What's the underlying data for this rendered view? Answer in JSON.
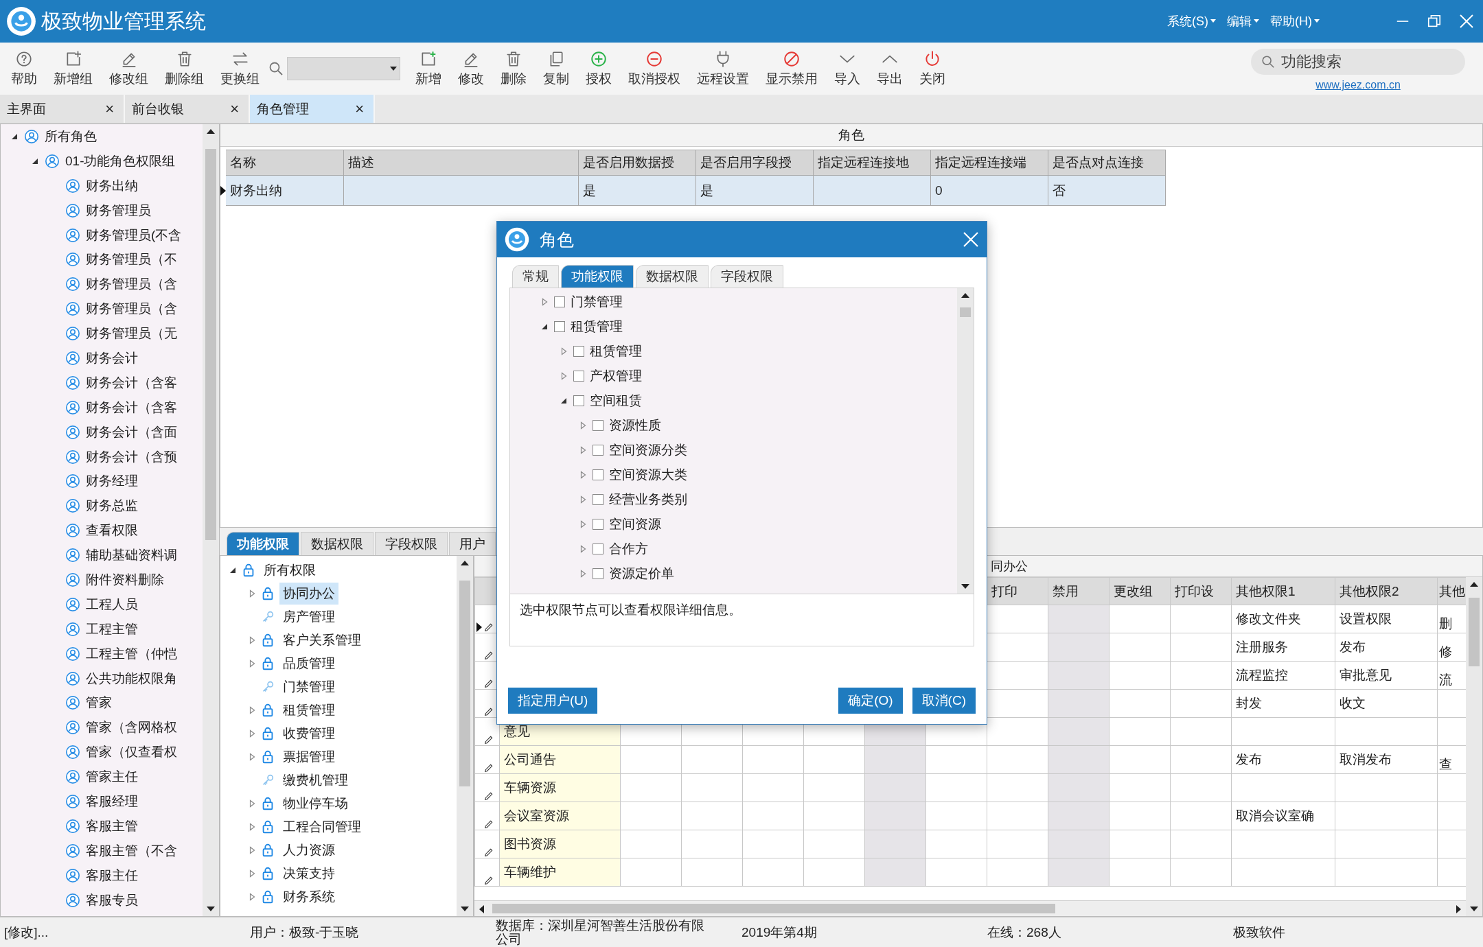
{
  "window": {
    "title": "极致物业管理系统",
    "menus": [
      "系统(S)",
      "编辑",
      "帮助(H)"
    ]
  },
  "toolbar": {
    "group_buttons": [
      "帮助",
      "新增组",
      "修改组",
      "删除组",
      "更换组"
    ],
    "buttons": [
      "新增",
      "修改",
      "删除",
      "复制",
      "授权",
      "取消授权",
      "远程设置",
      "显示禁用",
      "导入",
      "导出",
      "关闭"
    ],
    "search": {
      "placeholder": "功能搜索"
    },
    "link": "www.jeez.com.cn"
  },
  "tabs": [
    {
      "label": "主界面",
      "close": "×",
      "selected": false
    },
    {
      "label": "前台收银",
      "close": "×",
      "selected": false
    },
    {
      "label": "角色管理",
      "close": "×",
      "selected": true
    }
  ],
  "role_tree": {
    "label": "所有角色",
    "expanded": true,
    "children": [
      {
        "label": "01-功能角色权限组",
        "expanded": true,
        "children": [
          {
            "label": "财务出纳"
          },
          {
            "label": "财务管理员"
          },
          {
            "label": "财务管理员(不含"
          },
          {
            "label": "财务管理员（不"
          },
          {
            "label": "财务管理员（含"
          },
          {
            "label": "财务管理员（含"
          },
          {
            "label": "财务管理员（无"
          },
          {
            "label": "财务会计"
          },
          {
            "label": "财务会计（含客"
          },
          {
            "label": "财务会计（含客"
          },
          {
            "label": "财务会计（含面"
          },
          {
            "label": "财务会计（含预"
          },
          {
            "label": "财务经理"
          },
          {
            "label": "财务总监"
          },
          {
            "label": "查看权限"
          },
          {
            "label": "辅助基础资料调"
          },
          {
            "label": "附件资料删除"
          },
          {
            "label": "工程人员"
          },
          {
            "label": "工程主管"
          },
          {
            "label": "工程主管（仲恺"
          },
          {
            "label": "公共功能权限角"
          },
          {
            "label": "管家"
          },
          {
            "label": "管家（含网格权"
          },
          {
            "label": "管家（仅查看权"
          },
          {
            "label": "管家主任"
          },
          {
            "label": "客服经理"
          },
          {
            "label": "客服主管"
          },
          {
            "label": "客服主管（不含"
          },
          {
            "label": "客服主任"
          },
          {
            "label": "客服专员"
          }
        ]
      }
    ]
  },
  "role_table": {
    "caption": "角色",
    "columns": [
      "名称",
      "描述",
      "是否启用数据授",
      "是否启用字段授",
      "指定远程连接地",
      "指定远程连接端",
      "是否点对点连接"
    ],
    "rows": [
      {
        "current": true,
        "cells": [
          "财务出纳",
          null,
          "是",
          "是",
          null,
          "0",
          "否"
        ]
      }
    ]
  },
  "perm_tabs": [
    {
      "label": "功能权限",
      "selected": true
    },
    {
      "label": "数据权限",
      "selected": false
    },
    {
      "label": "字段权限",
      "selected": false
    },
    {
      "label": "用户",
      "selected": false
    }
  ],
  "perm_tree": {
    "label": "所有权限",
    "expanded": true,
    "children": [
      {
        "label": "协同办公",
        "kind": "group",
        "expanded": false,
        "selected": true
      },
      {
        "label": "房产管理",
        "kind": "leaf",
        "selected": false
      },
      {
        "label": "客户关系管理",
        "kind": "group",
        "expanded": false,
        "selected": false
      },
      {
        "label": "品质管理",
        "kind": "group",
        "expanded": false,
        "selected": false
      },
      {
        "label": "门禁管理",
        "kind": "leaf",
        "selected": false
      },
      {
        "label": "租赁管理",
        "kind": "group",
        "expanded": false,
        "selected": false
      },
      {
        "label": "收费管理",
        "kind": "group",
        "expanded": false,
        "selected": false
      },
      {
        "label": "票据管理",
        "kind": "group",
        "expanded": false,
        "selected": false
      },
      {
        "label": "缴费机管理",
        "kind": "leaf",
        "selected": false
      },
      {
        "label": "物业停车场",
        "kind": "group",
        "expanded": false,
        "selected": false
      },
      {
        "label": "工程合同管理",
        "kind": "group",
        "expanded": false,
        "selected": false
      },
      {
        "label": "人力资源",
        "kind": "group",
        "expanded": false,
        "selected": false
      },
      {
        "label": "决策支持",
        "kind": "group",
        "expanded": false,
        "selected": false
      },
      {
        "label": "财务系统",
        "kind": "group",
        "expanded": false,
        "selected": false
      }
    ]
  },
  "grid": {
    "caption": "同办公",
    "columns": [
      {
        "shaded": false
      },
      {
        "shaded": false
      },
      {
        "shaded": false
      },
      {
        "shaded": false
      },
      {
        "shaded": true
      },
      {
        "shaded": false
      },
      {
        "label": "打印",
        "shaded": false
      },
      {
        "label": "禁用",
        "shaded": true
      },
      {
        "label": "更改组",
        "shaded": false
      },
      {
        "label": "打印设",
        "shaded": false
      },
      {
        "label": "其他权限1",
        "shaded": false
      },
      {
        "label": "其他权限2",
        "shaded": false
      },
      {
        "label": "其他",
        "shaded": false
      }
    ],
    "rows": [
      {
        "current": true,
        "other_1": "修改文件夹",
        "other_2": "设置权限",
        "other_3": "删"
      },
      {
        "current": false,
        "other_1": "注册服务",
        "other_2": "发布",
        "other_3": "修"
      },
      {
        "current": false,
        "other_1": "流程监控",
        "other_2": "审批意见",
        "other_3": "流"
      },
      {
        "current": false,
        "other_1": "封发",
        "other_2": "收文"
      },
      {
        "current": false,
        "name": "意见"
      },
      {
        "current": false,
        "name": "公司通告",
        "other_1": "发布",
        "other_2": "取消发布",
        "other_3": "查"
      },
      {
        "current": false,
        "name": "车辆资源"
      },
      {
        "current": false,
        "name": "会议室资源",
        "other_1": "取消会议室确"
      },
      {
        "current": false,
        "name": "图书资源"
      },
      {
        "current": false,
        "name": "车辆维护"
      }
    ]
  },
  "dialog": {
    "title": "角色",
    "tabs": [
      {
        "label": "常规",
        "selected": false
      },
      {
        "label": "功能权限",
        "selected": true
      },
      {
        "label": "数据权限",
        "selected": false
      },
      {
        "label": "字段权限",
        "selected": false
      }
    ],
    "tree": [
      {
        "label": "门禁管理",
        "checked": false,
        "expanded": false
      },
      {
        "label": "租赁管理",
        "checked": false,
        "expanded": true,
        "children": [
          {
            "label": "租赁管理",
            "checked": false,
            "expanded": false
          },
          {
            "label": "产权管理",
            "checked": false,
            "expanded": false
          },
          {
            "label": "空间租赁",
            "checked": false,
            "expanded": true,
            "children": [
              {
                "label": "资源性质",
                "checked": false,
                "expanded": false
              },
              {
                "label": "空间资源分类",
                "checked": false,
                "expanded": false
              },
              {
                "label": "空间资源大类",
                "checked": false,
                "expanded": false
              },
              {
                "label": "经营业务类别",
                "checked": false,
                "expanded": false
              },
              {
                "label": "空间资源",
                "checked": false,
                "expanded": false
              },
              {
                "label": "合作方",
                "checked": false,
                "expanded": false
              },
              {
                "label": "资源定价单",
                "checked": false,
                "expanded": false
              }
            ]
          }
        ]
      }
    ],
    "info": "选中权限节点可以查看权限详细信息。",
    "assign_button": "指定用户(U)",
    "ok_button": "确定(O)",
    "cancel_button": "取消(C)"
  },
  "status_bar": [
    "[修改]...",
    "用户：极致-于玉晓",
    "数据库：深圳星河智善生活股份有限公司",
    "2019年第4期",
    "在线：268人",
    "极致软件"
  ]
}
